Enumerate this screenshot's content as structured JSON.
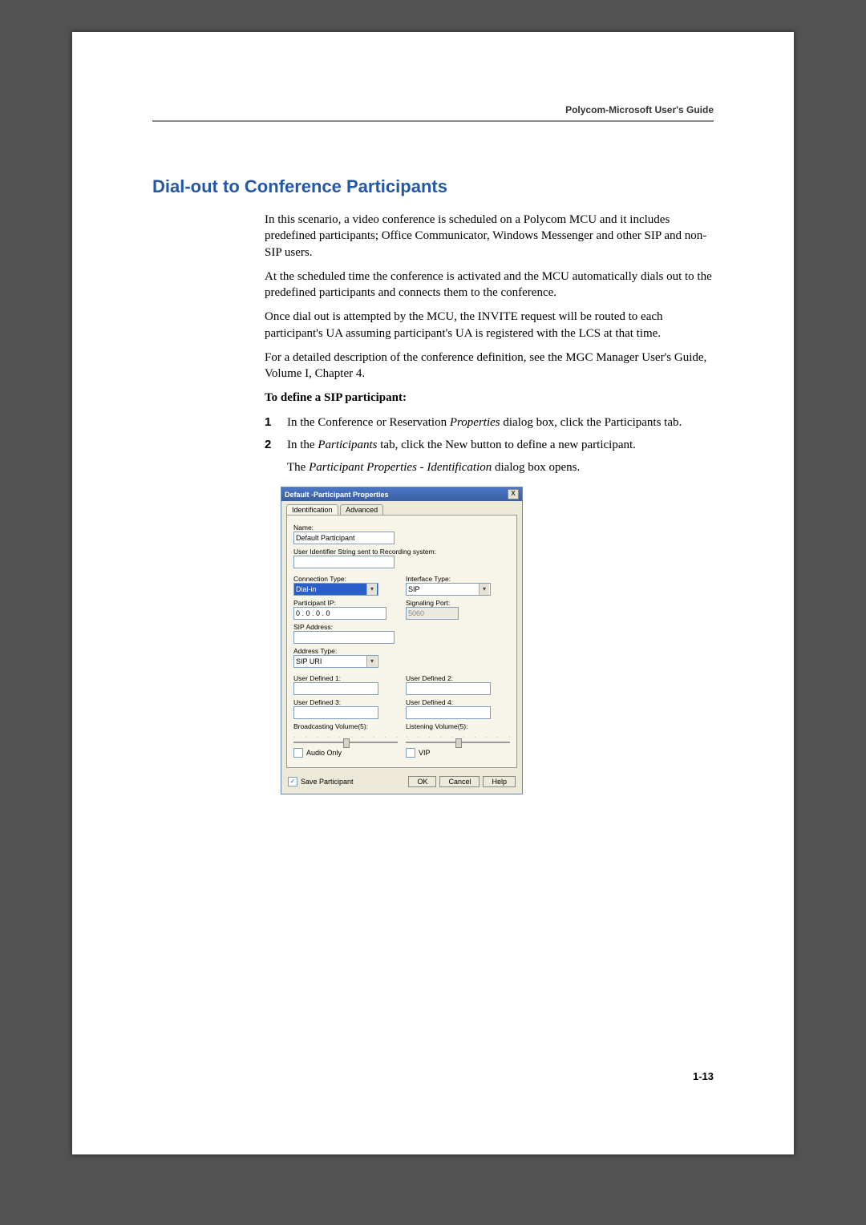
{
  "header": {
    "guide": "Polycom-Microsoft User's Guide"
  },
  "section": {
    "title": "Dial-out to Conference Participants"
  },
  "para": {
    "p1a": "In this scenario, a video conference is scheduled on a Polycom MCU and it includes predefined participants; Office Communicator, Windows Messenger and other SIP and non-SIP users.",
    "p2": "At the scheduled time the conference is activated and the MCU automatically dials out to the predefined participants and connects them to the conference.",
    "p3": "Once dial out is attempted by the MCU, the INVITE request will be routed to each participant's UA assuming participant's UA is registered with the LCS at that time.",
    "p4": "For a detailed description of the conference definition, see the MGC Manager User's Guide, Volume I, Chapter 4.",
    "lead": "To define a SIP participant:",
    "s1_a": "In the Conference or Reservation ",
    "s1_b": "Properties",
    "s1_c": " dialog box, click the ",
    "s1_d": "Participants",
    "s1_e": " tab.",
    "s2_a": "In the ",
    "s2_b": "Participants",
    "s2_c": " tab, click the ",
    "s2_d": "New",
    "s2_e": " button to define a new participant.",
    "result_a": "The ",
    "result_b": "Participant Properties - Identification",
    "result_c": " dialog box opens."
  },
  "steps": {
    "n1": "1",
    "n2": "2"
  },
  "dialog": {
    "title": "Default -Participant Properties",
    "close": "X",
    "tabs": {
      "identification": "Identification",
      "advanced": "Advanced"
    },
    "labels": {
      "name": "Name:",
      "user_ident": "User Identifier String sent to Recording system:",
      "conn_type": "Connection Type:",
      "iface_type": "Interface Type:",
      "part_ip": "Participant IP:",
      "sig_port": "Signaling Port:",
      "sip_addr": "SIP Address:",
      "addr_type": "Address Type:",
      "ud1": "User Defined 1:",
      "ud2": "User Defined 2:",
      "ud3": "User Defined 3:",
      "ud4": "User Defined 4:",
      "bcast_vol": "Broadcasting Volume(5):",
      "listen_vol": "Listening Volume(5):",
      "audio_only": "Audio Only",
      "vip": "VIP",
      "save_part": "Save Participant"
    },
    "values": {
      "name": "Default Participant",
      "conn_type": "Dial-in",
      "iface_type": "SIP",
      "ip": "0   .   0   .   0   .   0",
      "sig_port": "5060",
      "addr_type": "SIP URI"
    },
    "buttons": {
      "ok": "OK",
      "cancel": "Cancel",
      "help": "Help"
    },
    "save_checked": "✓"
  },
  "footer": {
    "page": "1-13"
  }
}
